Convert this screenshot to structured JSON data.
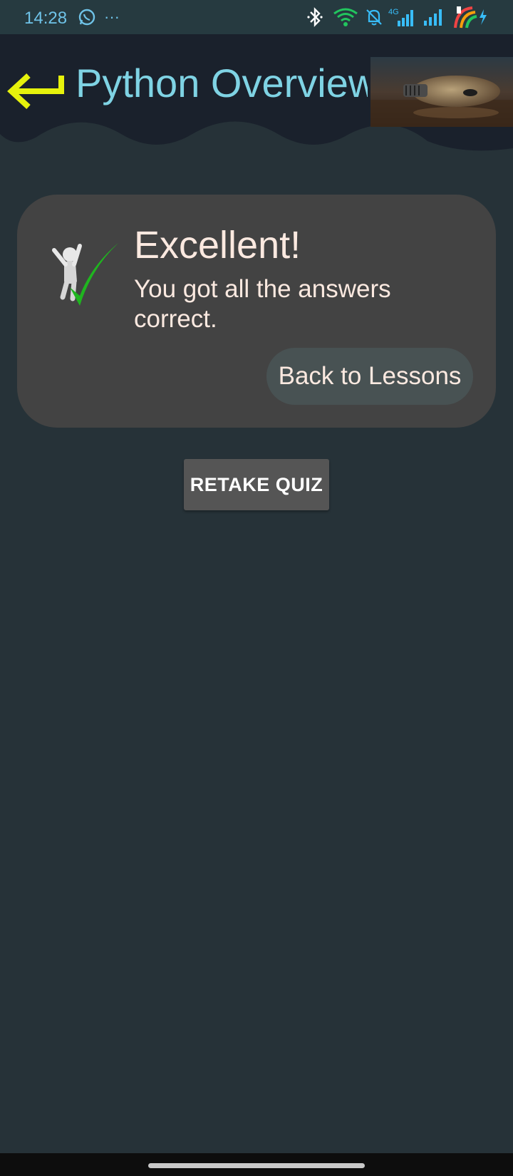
{
  "status_bar": {
    "time": "14:28",
    "more_dots": "···",
    "network_label": "4G",
    "icons": [
      "whatsapp-icon",
      "more-icon",
      "bluetooth-icon",
      "wifi-icon",
      "notifications-off-icon",
      "signal-4g-icon",
      "signal-icon",
      "battery-charging-icon"
    ]
  },
  "header": {
    "title": "Python Overview",
    "back_icon": "return-arrow-icon",
    "image": "lightbulb-photo"
  },
  "result": {
    "heading": "Excellent!",
    "message": "You got all the answers correct.",
    "back_button_label": "Back to Lessons",
    "icon": "celebration-checkmark-icon"
  },
  "retake_button_label": "RETAKE QUIZ",
  "colors": {
    "background": "#263238",
    "header": "#1a212c",
    "title": "#7fd3e4",
    "back_arrow": "#e6f20c",
    "card": "#434343",
    "text": "#fbe9e0",
    "checkmark": "#1fb51f"
  }
}
